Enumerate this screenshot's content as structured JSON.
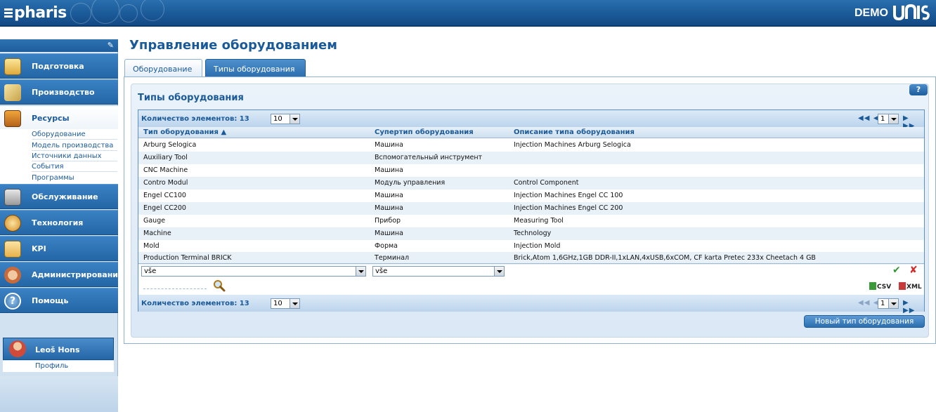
{
  "header": {
    "logo": "pharis",
    "demo": "DEMO",
    "unis": "UNIS"
  },
  "sidebar": {
    "items": [
      {
        "label": "Подготовка",
        "icon": "folder-icon"
      },
      {
        "label": "Производство",
        "icon": "production-icon"
      },
      {
        "label": "Ресурсы",
        "icon": "resources-icon"
      },
      {
        "label": "Обслуживание",
        "icon": "maintenance-icon"
      },
      {
        "label": "Технология",
        "icon": "technology-icon"
      },
      {
        "label": "KPI",
        "icon": "chart-icon"
      },
      {
        "label": "Администрирование",
        "icon": "admin-icon"
      },
      {
        "label": "Помощь",
        "icon": "help-icon"
      }
    ],
    "sub_items": [
      "Оборудование",
      "Модель производства",
      "Источники данных",
      "События",
      "Программы"
    ],
    "user": "Leoš Hons",
    "profile": "Профиль"
  },
  "main": {
    "title": "Управление оборудованием",
    "tabs": [
      "Оборудование",
      "Типы оборудования"
    ],
    "section_title": "Типы оборудования",
    "help": "?",
    "count_label": "Количество элементов: 13",
    "page_size": "10",
    "page": "1",
    "columns": [
      "Тип оборудования",
      "Супертип оборудования",
      "Описание типа оборудования"
    ],
    "rows": [
      [
        "Arburg Selogica",
        "Машина",
        "Injection Machines Arburg Selogica"
      ],
      [
        "Auxiliary Tool",
        "Вспомогательный инструмент",
        ""
      ],
      [
        "CNC Machine",
        "Машина",
        ""
      ],
      [
        "Contro Modul",
        "Модуль управления",
        "Control Component"
      ],
      [
        "Engel CC100",
        "Машина",
        "Injection Machines Engel CC 100"
      ],
      [
        "Engel CC200",
        "Машина",
        "Injection Machines Engel CC 200"
      ],
      [
        "Gauge",
        "Прибор",
        "Measuring Tool"
      ],
      [
        "Machine",
        "Машина",
        "Technology"
      ],
      [
        "Mold",
        "Форма",
        "Injection Mold"
      ],
      [
        "Production Terminal BRICK",
        "Терминал",
        "Brick,Atom 1,6GHz,1GB DDR-II,1xLAN,4xUSB,6xCOM, CF karta Pretec 233x Cheetach 4 GB"
      ]
    ],
    "filter1": "vše",
    "filter2": "vše",
    "csv": "CSV",
    "xml": "XML",
    "new_button": "Новый тип оборудования"
  }
}
